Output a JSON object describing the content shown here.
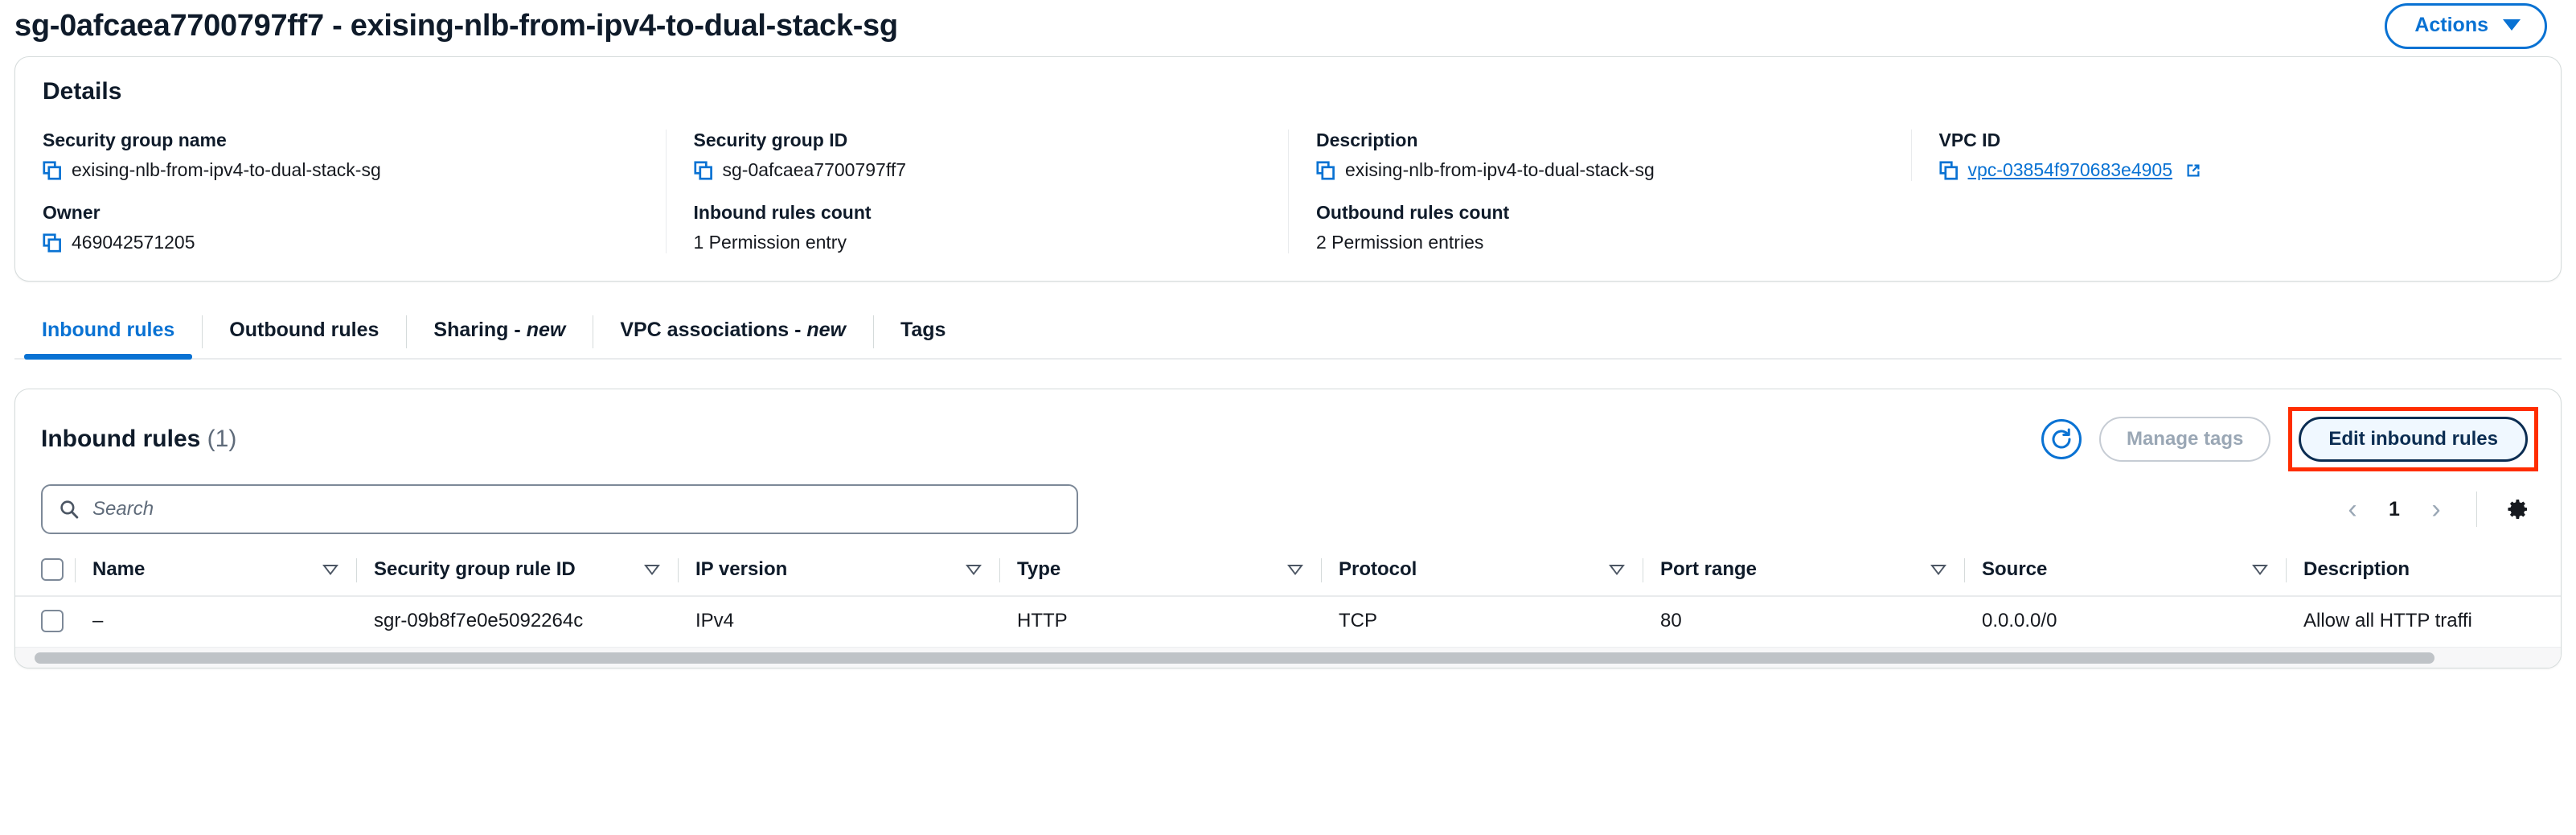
{
  "header": {
    "title": "sg-0afcaea7700797ff7 - exising-nlb-from-ipv4-to-dual-stack-sg",
    "actions_label": "Actions",
    "caret_icon": "caret-down-icon"
  },
  "details": {
    "title": "Details",
    "fields": [
      {
        "label": "Security group name",
        "value": "exising-nlb-from-ipv4-to-dual-stack-sg",
        "copyable": true,
        "link": false
      },
      {
        "label": "Security group ID",
        "value": "sg-0afcaea7700797ff7",
        "copyable": true,
        "link": false
      },
      {
        "label": "Description",
        "value": "exising-nlb-from-ipv4-to-dual-stack-sg",
        "copyable": true,
        "link": false
      },
      {
        "label": "VPC ID",
        "value": "vpc-03854f970683e4905",
        "copyable": true,
        "link": true,
        "external_icon": "external-link-icon"
      },
      {
        "label": "Owner",
        "value": "469042571205",
        "copyable": true,
        "link": false
      },
      {
        "label": "Inbound rules count",
        "value": "1 Permission entry",
        "copyable": false,
        "link": false
      },
      {
        "label": "Outbound rules count",
        "value": "2 Permission entries",
        "copyable": false,
        "link": false
      }
    ]
  },
  "tabs": [
    {
      "label": "Inbound rules",
      "new": "",
      "active": true
    },
    {
      "label": "Outbound rules",
      "new": "",
      "active": false
    },
    {
      "label": "Sharing",
      "new": "new",
      "active": false
    },
    {
      "label": "VPC associations",
      "new": "new",
      "active": false
    },
    {
      "label": "Tags",
      "new": "",
      "active": false
    }
  ],
  "panel": {
    "title": "Inbound rules",
    "count": "(1)",
    "refresh_icon": "refresh-icon",
    "manage_tags_label": "Manage tags",
    "edit_rules_label": "Edit inbound rules",
    "search_placeholder": "Search",
    "search_value": "",
    "search_icon": "search-icon",
    "pager": {
      "prev_icon": "chevron-left-icon",
      "page": "1",
      "next_icon": "chevron-right-icon",
      "settings_icon": "gear-icon"
    },
    "columns": [
      {
        "label": "Name",
        "sortable": true
      },
      {
        "label": "Security group rule ID",
        "sortable": true
      },
      {
        "label": "IP version",
        "sortable": true
      },
      {
        "label": "Type",
        "sortable": true
      },
      {
        "label": "Protocol",
        "sortable": true
      },
      {
        "label": "Port range",
        "sortable": true
      },
      {
        "label": "Source",
        "sortable": true
      },
      {
        "label": "Description",
        "sortable": false
      }
    ],
    "rows": [
      {
        "name": "–",
        "rule_id": "sgr-09b8f7e0e5092264c",
        "ip_version": "IPv4",
        "type": "HTTP",
        "protocol": "TCP",
        "port_range": "80",
        "source": "0.0.0.0/0",
        "description": "Allow all HTTP traffi"
      }
    ]
  },
  "colors": {
    "link_blue": "#0972d3",
    "dark_navy": "#0b2d52",
    "highlight_red": "#ff2d00",
    "muted_grey": "#5f6b7a"
  }
}
